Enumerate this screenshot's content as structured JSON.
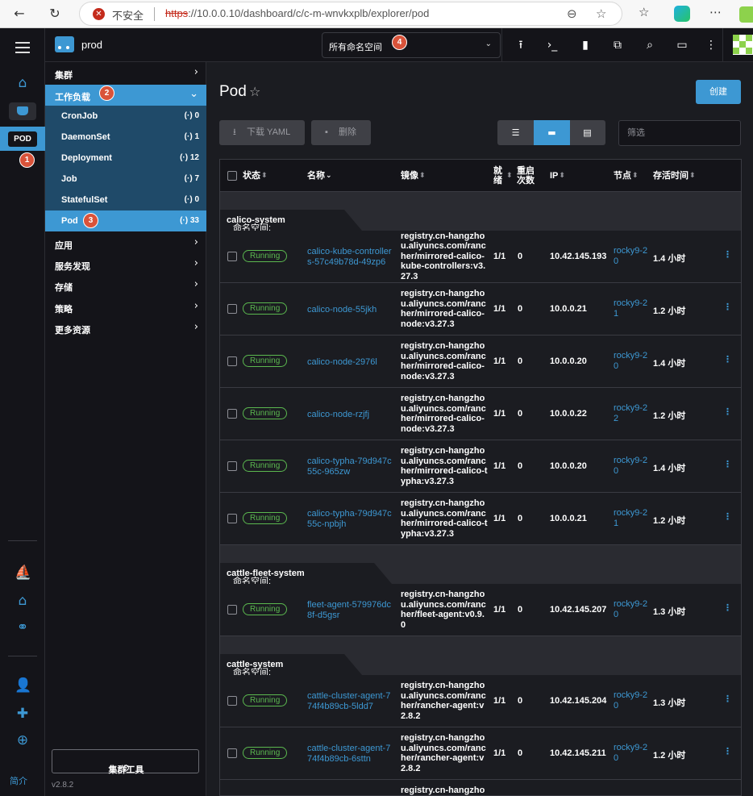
{
  "browser": {
    "insecure_label": "不安全",
    "url_scheme": "https",
    "url_rest": "://10.0.0.10/dashboard/c/c-m-wnvkxplb/explorer/pod"
  },
  "rail": {
    "pod_badge": "POD",
    "intro": "简介"
  },
  "header": {
    "cluster_name": "prod",
    "namespace_select": "所有命名空间"
  },
  "markers": [
    "1",
    "2",
    "3",
    "4"
  ],
  "sidenav": {
    "groups": [
      {
        "label": "集群"
      },
      {
        "label": "工作负载"
      },
      {
        "label": "应用"
      },
      {
        "label": "服务发现"
      },
      {
        "label": "存储"
      },
      {
        "label": "策略"
      },
      {
        "label": "更多资源"
      }
    ],
    "workloads": [
      {
        "label": "CronJob",
        "count": "0"
      },
      {
        "label": "DaemonSet",
        "count": "1"
      },
      {
        "label": "Deployment",
        "count": "12"
      },
      {
        "label": "Job",
        "count": "7"
      },
      {
        "label": "StatefulSet",
        "count": "0"
      },
      {
        "label": "Pod",
        "count": "33"
      }
    ],
    "cluster_tools": "集群工具",
    "version": "v2.8.2"
  },
  "main": {
    "title": "Pod",
    "create_label": "创建",
    "download_yaml": "下载 YAML",
    "delete_label": "删除",
    "filter_placeholder": "筛选"
  },
  "table": {
    "headers": {
      "state": "状态",
      "name": "名称",
      "image": "镜像",
      "ready": "就绪",
      "restarts": "重启次数",
      "ip": "IP",
      "node": "节点",
      "age": "存活时间"
    },
    "namespace_prefix": "命名空间:",
    "groups": [
      {
        "namespace": "calico-system",
        "rows": [
          {
            "state": "Running",
            "name": "calico-kube-controllers-57c49b78d-49zp6",
            "image": "registry.cn-hangzhou.aliyuncs.com/rancher/mirrored-calico-kube-controllers:v3.27.3",
            "ready": "1/1",
            "restarts": "0",
            "ip": "10.42.145.193",
            "node": "rocky9-20",
            "age": "1.4 小时"
          },
          {
            "state": "Running",
            "name": "calico-node-55jkh",
            "image": "registry.cn-hangzhou.aliyuncs.com/rancher/mirrored-calico-node:v3.27.3",
            "ready": "1/1",
            "restarts": "0",
            "ip": "10.0.0.21",
            "node": "rocky9-21",
            "age": "1.2 小时"
          },
          {
            "state": "Running",
            "name": "calico-node-2976l",
            "image": "registry.cn-hangzhou.aliyuncs.com/rancher/mirrored-calico-node:v3.27.3",
            "ready": "1/1",
            "restarts": "0",
            "ip": "10.0.0.20",
            "node": "rocky9-20",
            "age": "1.4 小时"
          },
          {
            "state": "Running",
            "name": "calico-node-rzjfj",
            "image": "registry.cn-hangzhou.aliyuncs.com/rancher/mirrored-calico-node:v3.27.3",
            "ready": "1/1",
            "restarts": "0",
            "ip": "10.0.0.22",
            "node": "rocky9-22",
            "age": "1.2 小时"
          },
          {
            "state": "Running",
            "name": "calico-typha-79d947c55c-965zw",
            "image": "registry.cn-hangzhou.aliyuncs.com/rancher/mirrored-calico-typha:v3.27.3",
            "ready": "1/1",
            "restarts": "0",
            "ip": "10.0.0.20",
            "node": "rocky9-20",
            "age": "1.4 小时"
          },
          {
            "state": "Running",
            "name": "calico-typha-79d947c55c-npbjh",
            "image": "registry.cn-hangzhou.aliyuncs.com/rancher/mirrored-calico-typha:v3.27.3",
            "ready": "1/1",
            "restarts": "0",
            "ip": "10.0.0.21",
            "node": "rocky9-21",
            "age": "1.2 小时"
          }
        ]
      },
      {
        "namespace": "cattle-fleet-system",
        "rows": [
          {
            "state": "Running",
            "name": "fleet-agent-579976dc8f-d5gsr",
            "image": "registry.cn-hangzhou.aliyuncs.com/rancher/fleet-agent:v0.9.0",
            "ready": "1/1",
            "restarts": "0",
            "ip": "10.42.145.207",
            "node": "rocky9-20",
            "age": "1.3 小时"
          }
        ]
      },
      {
        "namespace": "cattle-system",
        "rows": [
          {
            "state": "Running",
            "name": "cattle-cluster-agent-774f4b89cb-5ldd7",
            "image": "registry.cn-hangzhou.aliyuncs.com/rancher/rancher-agent:v2.8.2",
            "ready": "1/1",
            "restarts": "0",
            "ip": "10.42.145.204",
            "node": "rocky9-20",
            "age": "1.3 小时"
          },
          {
            "state": "Running",
            "name": "cattle-cluster-agent-774f4b89cb-6sttn",
            "image": "registry.cn-hangzhou.aliyuncs.com/rancher/rancher-agent:v2.8.2",
            "ready": "1/1",
            "restarts": "0",
            "ip": "10.42.145.211",
            "node": "rocky9-20",
            "age": "1.2 小时"
          }
        ]
      }
    ],
    "partial_row_image": "registry.cn-hangzhou."
  },
  "colors": {
    "accent": "#3d98d3",
    "running": "#5bb84f",
    "marker": "#d9533a"
  }
}
